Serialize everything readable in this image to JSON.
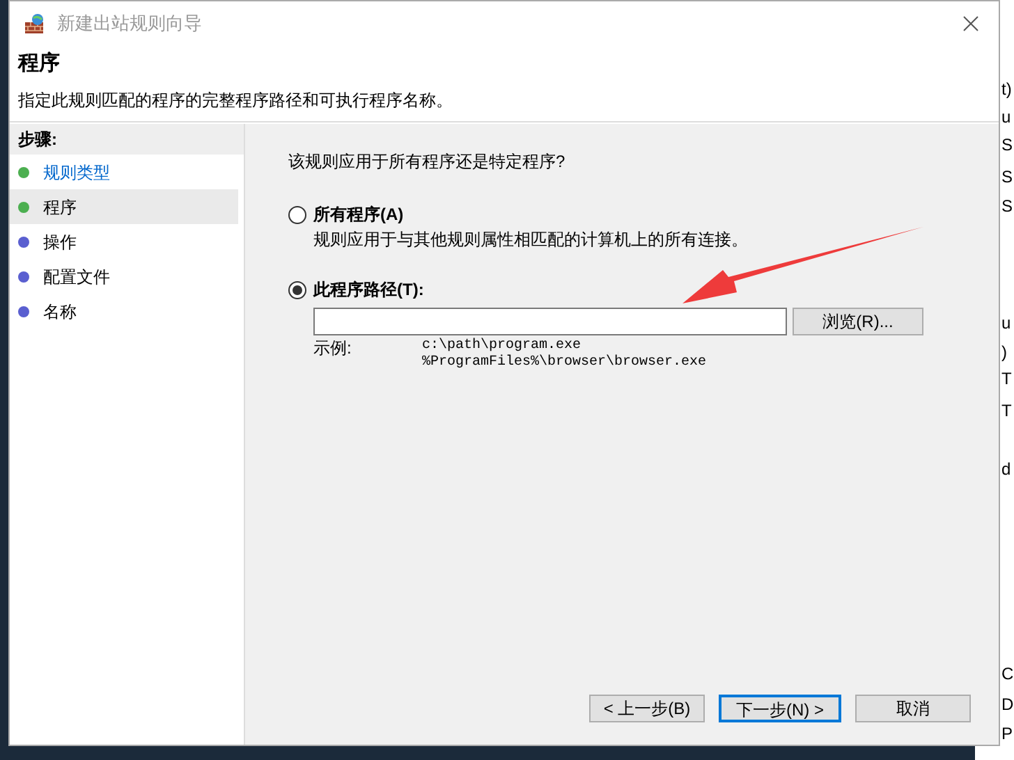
{
  "window": {
    "title": "新建出站规则向导"
  },
  "header": {
    "title": "程序",
    "description": "指定此规则匹配的程序的完整程序路径和可执行程序名称。"
  },
  "steps": {
    "heading": "步骤:",
    "items": [
      {
        "label": "规则类型",
        "kind": "link",
        "selected": false,
        "color": "#4caf50"
      },
      {
        "label": "程序",
        "kind": "plain",
        "selected": true,
        "color": "#4caf50"
      },
      {
        "label": "操作",
        "kind": "plain",
        "selected": false,
        "color": "#5a5fd0"
      },
      {
        "label": "配置文件",
        "kind": "plain",
        "selected": false,
        "color": "#5a5fd0"
      },
      {
        "label": "名称",
        "kind": "plain",
        "selected": false,
        "color": "#5a5fd0"
      }
    ]
  },
  "question": "该规则应用于所有程序还是特定程序?",
  "options": [
    {
      "label": "所有程序(A)",
      "description": "规则应用于与其他规则属性相匹配的计算机上的所有连接。",
      "selected": false
    },
    {
      "label": "此程序路径(T):",
      "selected": true
    }
  ],
  "path_field": {
    "browse_button": "浏览(R)...",
    "example_label": "示例:",
    "examples": [
      "c:\\path\\program.exe",
      "%ProgramFiles%\\browser\\browser.exe"
    ]
  },
  "buttons": [
    {
      "label": "< 上一步(B)",
      "default": false
    },
    {
      "label": "下一步(N) >",
      "default": true
    },
    {
      "label": "取消",
      "default": false
    }
  ],
  "background_window": {
    "fragments": [
      "t)",
      "u",
      "S",
      "S",
      "S",
      "u",
      ")",
      "T",
      "T",
      "d",
      "C",
      "D",
      "P"
    ]
  }
}
